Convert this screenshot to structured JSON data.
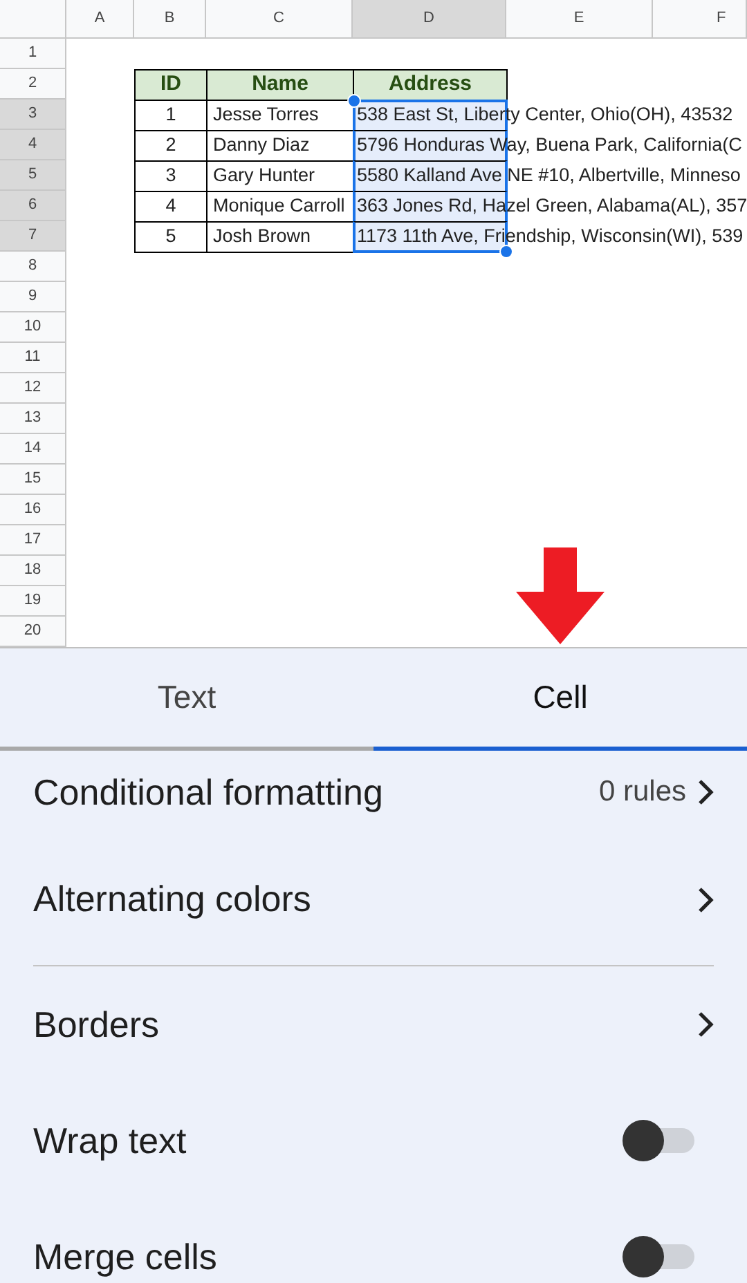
{
  "columns": [
    {
      "label": "A",
      "selected": false
    },
    {
      "label": "B",
      "selected": false
    },
    {
      "label": "C",
      "selected": false
    },
    {
      "label": "D",
      "selected": true
    },
    {
      "label": "E",
      "selected": false
    },
    {
      "label": "F",
      "selected": false
    }
  ],
  "rows": [
    {
      "label": "1",
      "selected": false
    },
    {
      "label": "2",
      "selected": false
    },
    {
      "label": "3",
      "selected": true
    },
    {
      "label": "4",
      "selected": true
    },
    {
      "label": "5",
      "selected": true
    },
    {
      "label": "6",
      "selected": true
    },
    {
      "label": "7",
      "selected": true
    },
    {
      "label": "8",
      "selected": false
    },
    {
      "label": "9",
      "selected": false
    },
    {
      "label": "10",
      "selected": false
    },
    {
      "label": "11",
      "selected": false
    },
    {
      "label": "12",
      "selected": false
    },
    {
      "label": "13",
      "selected": false
    },
    {
      "label": "14",
      "selected": false
    },
    {
      "label": "15",
      "selected": false
    },
    {
      "label": "16",
      "selected": false
    },
    {
      "label": "17",
      "selected": false
    },
    {
      "label": "18",
      "selected": false
    },
    {
      "label": "19",
      "selected": false
    },
    {
      "label": "20",
      "selected": false
    }
  ],
  "table": {
    "headers": [
      "ID",
      "Name",
      "Address"
    ],
    "rows": [
      {
        "id": "1",
        "name": "Jesse Torres",
        "address": "538 East St, Liberty Center, Ohio(OH), 43532",
        "selected": true
      },
      {
        "id": "2",
        "name": "Danny Diaz",
        "address": "5796 Honduras Way, Buena Park, California(C",
        "selected": true
      },
      {
        "id": "3",
        "name": "Gary Hunter",
        "address": "5580 Kalland Ave NE #10, Albertville, Minneso",
        "selected": true
      },
      {
        "id": "4",
        "name": "Monique Carroll",
        "address": "363 Jones Rd, Hazel Green, Alabama(AL), 357",
        "selected": true
      },
      {
        "id": "5",
        "name": "Josh Brown",
        "address": "1173 11th Ave, Friendship, Wisconsin(WI), 539",
        "selected": true
      }
    ]
  },
  "tabs": [
    {
      "label": "Text",
      "selected": false
    },
    {
      "label": "Cell",
      "selected": true
    }
  ],
  "sections": [
    [
      {
        "kind": "link",
        "label": "Conditional formatting",
        "value": "0 rules"
      },
      {
        "kind": "link",
        "label": "Alternating colors"
      }
    ],
    [
      {
        "kind": "link",
        "label": "Borders"
      },
      {
        "kind": "toggle",
        "label": "Wrap text",
        "on": false
      },
      {
        "kind": "toggle",
        "label": "Merge cells",
        "on": false
      }
    ]
  ]
}
